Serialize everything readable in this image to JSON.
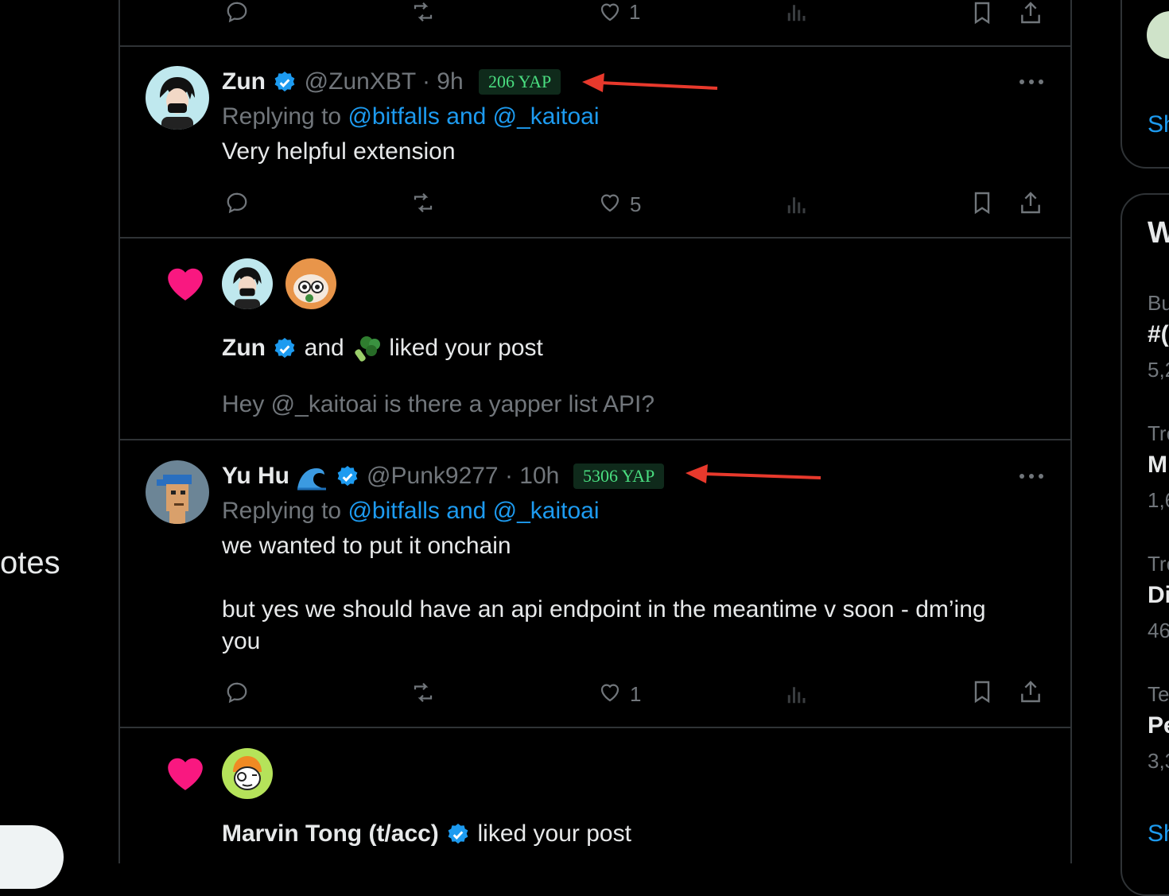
{
  "left_nav": {
    "notes_label_fragment": "otes"
  },
  "posts": [
    {
      "type": "reply",
      "name": "Zun",
      "handle": "@ZunXBT",
      "time": "· 9h",
      "yap": "206 YAP",
      "replying_prefix": "Replying to ",
      "replying_to": "@bitfalls and @_kaitoai",
      "text": "Very helpful extension",
      "likes": "5"
    },
    {
      "type": "reply",
      "name": "Yu Hu",
      "handle": "@Punk9277",
      "time": "· 10h",
      "yap": "5306 YAP",
      "replying_prefix": "Replying to ",
      "replying_to": "@bitfalls and @_kaitoai",
      "text_line1": "we wanted to put it onchain",
      "text_line2": "but yes we should have an api endpoint in the meantime v soon - dm’ing",
      "text_line3": "you",
      "likes": "1"
    }
  ],
  "top_partial_post": {
    "likes": "1"
  },
  "notifications": [
    {
      "type": "like",
      "actor": "Zun",
      "connector": "and",
      "suffix": "liked your post",
      "post_preview": "Hey @_kaitoai is there a yapper list API?"
    },
    {
      "type": "like",
      "actor": "Marvin Tong (t/acc)",
      "suffix": "liked your post"
    }
  ],
  "right_sidebar": {
    "show_more_fragment": "Sh",
    "heading_fragment": "W",
    "trends": [
      {
        "category": "Bu",
        "title": "#(",
        "count": "5,2"
      },
      {
        "category": "Tre",
        "title": "M",
        "count": "1,6"
      },
      {
        "category": "Tre",
        "title": "Di",
        "count": "46"
      },
      {
        "category": "Te",
        "title": "Pe",
        "count": "3,3"
      }
    ],
    "show_more_fragment_2": "Sh"
  },
  "colors": {
    "background": "#000000",
    "text": "#e7e9ea",
    "muted": "#71767b",
    "link": "#1d9bf0",
    "border": "#2f3336",
    "like_heart": "#f91880",
    "yap_badge_bg": "#0f2a1b",
    "yap_badge_text": "#4ade80",
    "annotation_arrow": "#e8392c"
  },
  "icons": [
    "reply-icon",
    "repost-icon",
    "like-icon",
    "views-icon",
    "bookmark-icon",
    "share-icon",
    "more-icon",
    "verified-badge-icon",
    "heart-notification-icon",
    "wave-emoji-icon",
    "broccoli-emoji-icon",
    "red-arrow-annotation"
  ]
}
